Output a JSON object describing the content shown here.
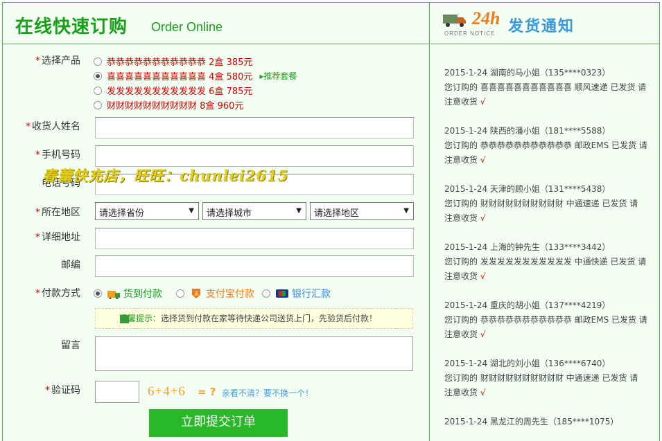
{
  "header": {
    "title_cn": "在线快速订购",
    "title_en": "Order Online"
  },
  "notice_header": {
    "badge": "24h",
    "order_notice": "ORDER NOTICE",
    "title": "发货通知"
  },
  "form": {
    "product_label": "选择产品",
    "products": [
      {
        "name": "恭恭恭恭恭恭恭恭恭恭恭",
        "qty": "2盒",
        "price": "385元",
        "selected": false
      },
      {
        "name": "喜喜喜喜喜喜喜喜喜喜喜",
        "qty": "4盒",
        "price": "580元",
        "selected": true,
        "tag": "▸推荐套餐"
      },
      {
        "name": "发发发发发发发发发发发",
        "qty": "6盒",
        "price": "785元",
        "selected": false
      },
      {
        "name": "财财财财财财财财财财",
        "qty": "8盒",
        "price": "960元",
        "selected": false
      }
    ],
    "name_label": "收货人姓名",
    "mobile_label": "手机号码",
    "phone_label": "电话号码",
    "region_label": "所在地区",
    "province_placeholder": "请选择省份",
    "city_placeholder": "请选择城市",
    "district_placeholder": "请选择地区",
    "address_label": "详细地址",
    "zip_label": "邮编",
    "pay_label": "付款方式",
    "pay_options": [
      {
        "label": "货到付款",
        "color": "#19a019",
        "selected": true
      },
      {
        "label": "支付宝付款",
        "color": "#f07a1a",
        "selected": false
      },
      {
        "label": "银行汇款",
        "color": "#3a8ad9",
        "selected": false
      }
    ],
    "tip_label": "温馨提示：",
    "tip_text": "选择货到付款在家等待快递公司送货上门，先验货后付款！",
    "message_label": "留言",
    "captcha_label": "验证码",
    "captcha_text": "6+4+6",
    "captcha_eq": "= ?",
    "captcha_refresh": "亲看不清？要不换一个！",
    "submit_label": "立即提交订单"
  },
  "watermark": "春蕾快充店，旺旺：chunlei2615",
  "notices": [
    {
      "line1": "2015-1-24 湖南的马小姐（135****0323）",
      "line2": "您订购的 喜喜喜喜喜喜喜喜喜喜喜 顺风速递 已发货 请",
      "line3": "注意收货"
    },
    {
      "line1": "2015-1-24 陕西的潘小姐（181****5588）",
      "line2": "您订购的 恭恭恭恭恭恭恭恭恭恭恭 邮政EMS 已发货 请",
      "line3": "注意收货"
    },
    {
      "line1": "2015-1-24 天津的顾小姐（131****5438）",
      "line2": "您订购的 财财财财财财财财财财 中通速递 已发货 请",
      "line3": "注意收货"
    },
    {
      "line1": "2015-1-24 上海的钟先生（133****3442）",
      "line2": "您订购的 发发发发发发发发发发发 中通快递 已发货 请",
      "line3": "注意收货"
    },
    {
      "line1": "2015-1-24 重庆的胡小姐（137****4219）",
      "line2": "您订购的 恭恭恭恭恭恭恭恭恭恭恭 邮政EMS 已发货 请",
      "line3": "注意收货"
    },
    {
      "line1": "2015-1-24 湖北的刘小姐（136****6740）",
      "line2": "您订购的 财财财财财财财财财财 中通速递 已发货 请",
      "line3": "注意收货"
    },
    {
      "line1": "2015-1-24 黑龙江的周先生（185****1075）",
      "line2": "",
      "line3": ""
    }
  ],
  "check_mark": "√",
  "colors": {
    "accent_green": "#19a019",
    "border_green": "#3cc23c",
    "price_red": "#d40000",
    "panel_bg": "#f2fff2"
  }
}
